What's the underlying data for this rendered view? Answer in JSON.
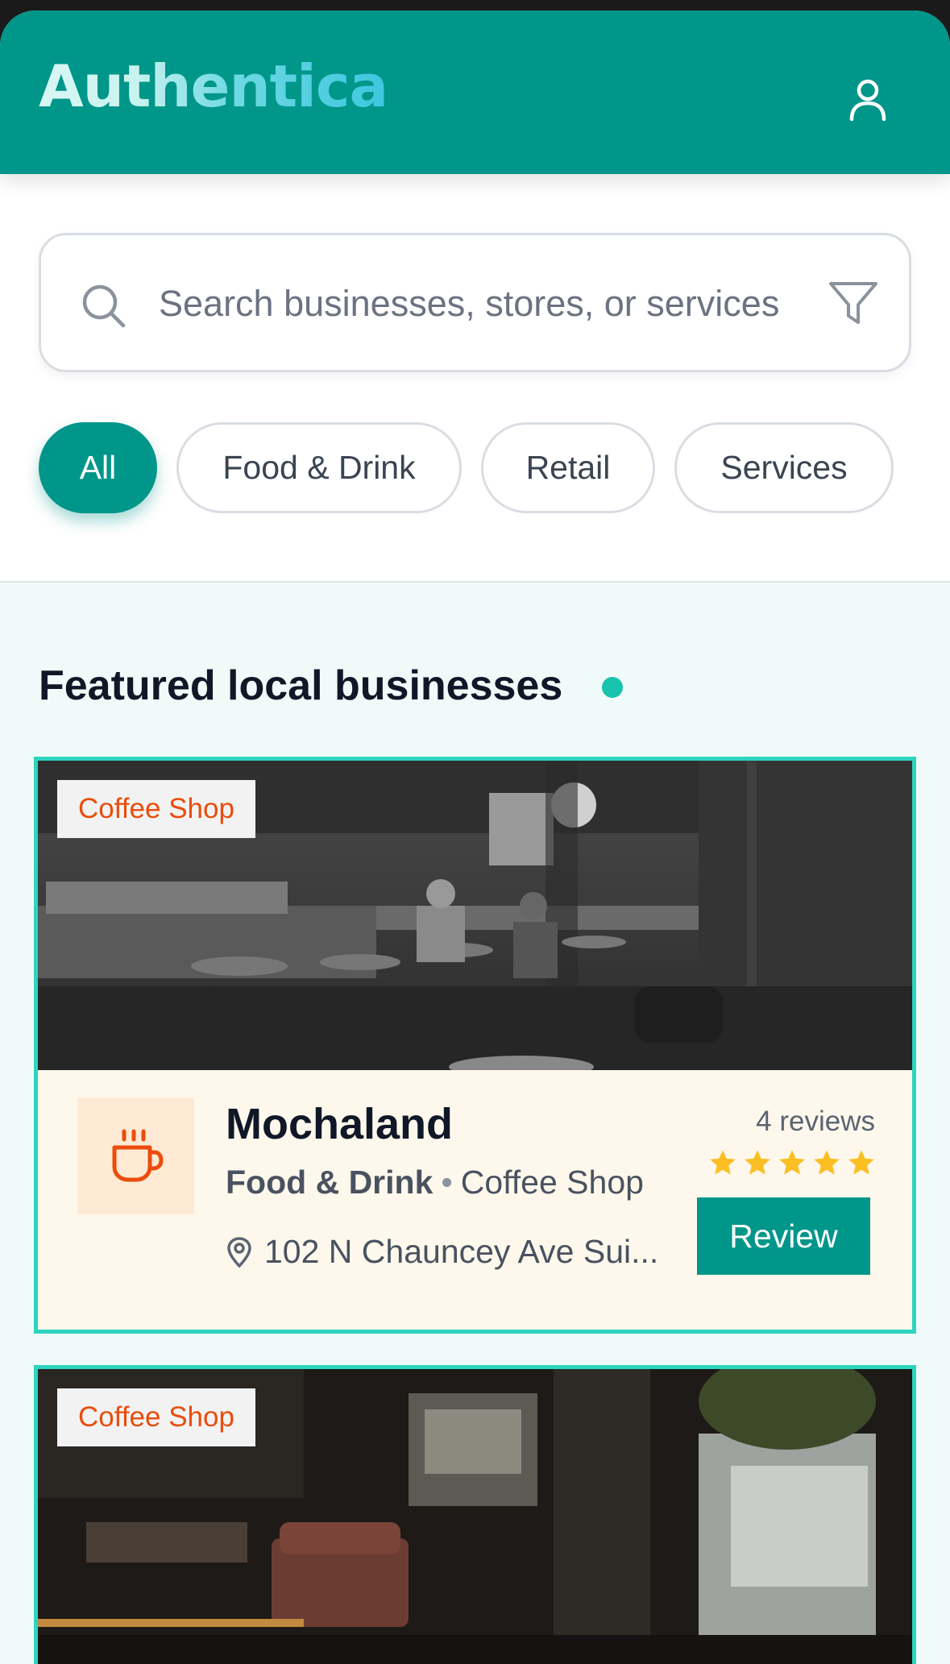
{
  "app": {
    "title": "Authentica"
  },
  "header": {
    "profile_icon": "user-icon"
  },
  "search": {
    "placeholder": "Search businesses, stores, or services",
    "search_icon": "search-icon",
    "filter_icon": "filter-icon"
  },
  "filters": [
    {
      "label": "All",
      "active": true
    },
    {
      "label": "Food & Drink",
      "active": false
    },
    {
      "label": "Retail",
      "active": false
    },
    {
      "label": "Services",
      "active": false
    }
  ],
  "section": {
    "title": "Featured local businesses"
  },
  "businesses": [
    {
      "tag": "Coffee Shop",
      "name": "Mochaland",
      "category": "Food & Drink",
      "subcategory": "Coffee Shop",
      "address": "102 N Chauncey Ave Sui...",
      "reviews": "4 reviews",
      "rating": 5,
      "action": "Review",
      "icon": "coffee-cup-icon"
    },
    {
      "tag": "Coffee Shop"
    }
  ],
  "colors": {
    "brand": "#00968a",
    "accent_teal": "#2dd4bf",
    "tag_text": "#ea4d0c",
    "star": "#fbbf24",
    "card_bg": "#fef8ec"
  }
}
